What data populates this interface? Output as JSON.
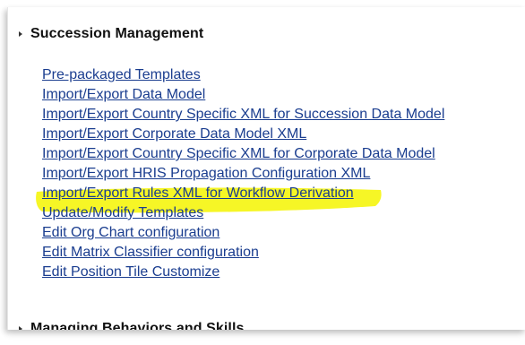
{
  "sections": [
    {
      "title": "Succession Management",
      "links": [
        "Pre-packaged Templates",
        "Import/Export Data Model",
        "Import/Export Country Specific XML for Succession Data Model",
        "Import/Export Corporate Data Model XML",
        "Import/Export Country Specific XML for Corporate Data Model",
        "Import/Export HRIS Propagation Configuration XML",
        "Import/Export Rules XML for Workflow Derivation",
        "Update/Modify Templates",
        "Edit Org Chart configuration",
        "Edit Matrix Classifier configuration",
        "Edit Position Tile Customize"
      ]
    },
    {
      "title": "Managing Behaviors and Skills"
    }
  ],
  "highlighted_link": "Import/Export Rules XML for Workflow Derivation",
  "colors": {
    "link": "#1a3d8f",
    "highlight": "#f5f500",
    "title": "#111111"
  }
}
